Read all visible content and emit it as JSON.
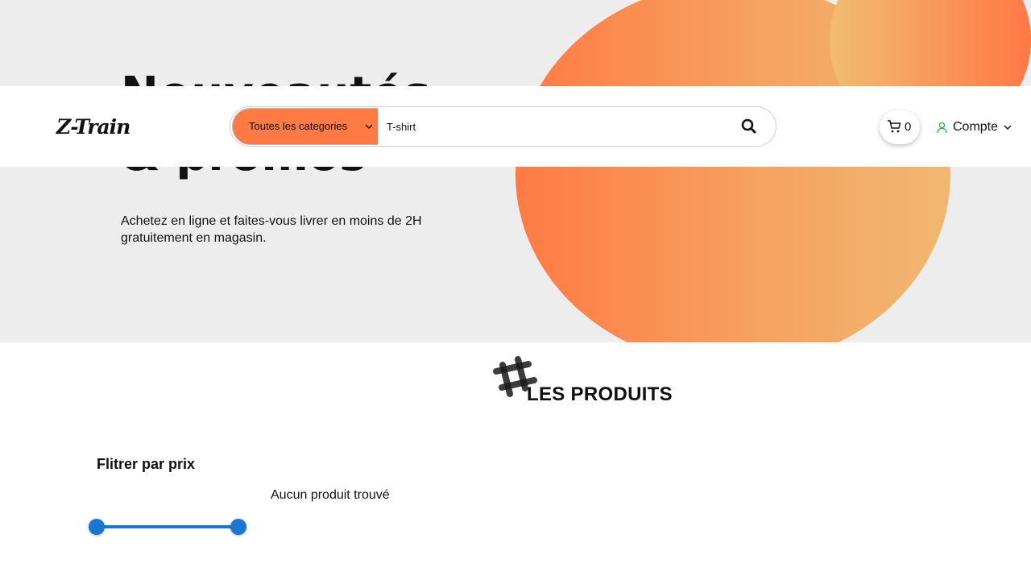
{
  "hero": {
    "title_line1": "Nouveautés",
    "title_line2": "& promos",
    "subtitle": "Achetez en ligne et faites-vous livrer en moins de 2H gratuitement en magasin."
  },
  "header": {
    "logo": "Z-Train",
    "search": {
      "category_label": "Toutes les categories",
      "value": "T-shirt",
      "icon": "search-icon"
    },
    "cart": {
      "count": "0",
      "icon": "cart-icon"
    },
    "account": {
      "label": "Compte",
      "icon": "user-icon"
    }
  },
  "products_section": {
    "title": "LES PRODUITS",
    "icon": "hash-icon",
    "empty_message": "Aucun produit trouvé"
  },
  "filter": {
    "title": "Flitrer par prix",
    "slider": {
      "min_fraction": 0,
      "max_fraction": 1
    }
  },
  "colors": {
    "accent": "#ff7a45",
    "slider": "#1976d2",
    "hero_bg": "#ededed"
  }
}
